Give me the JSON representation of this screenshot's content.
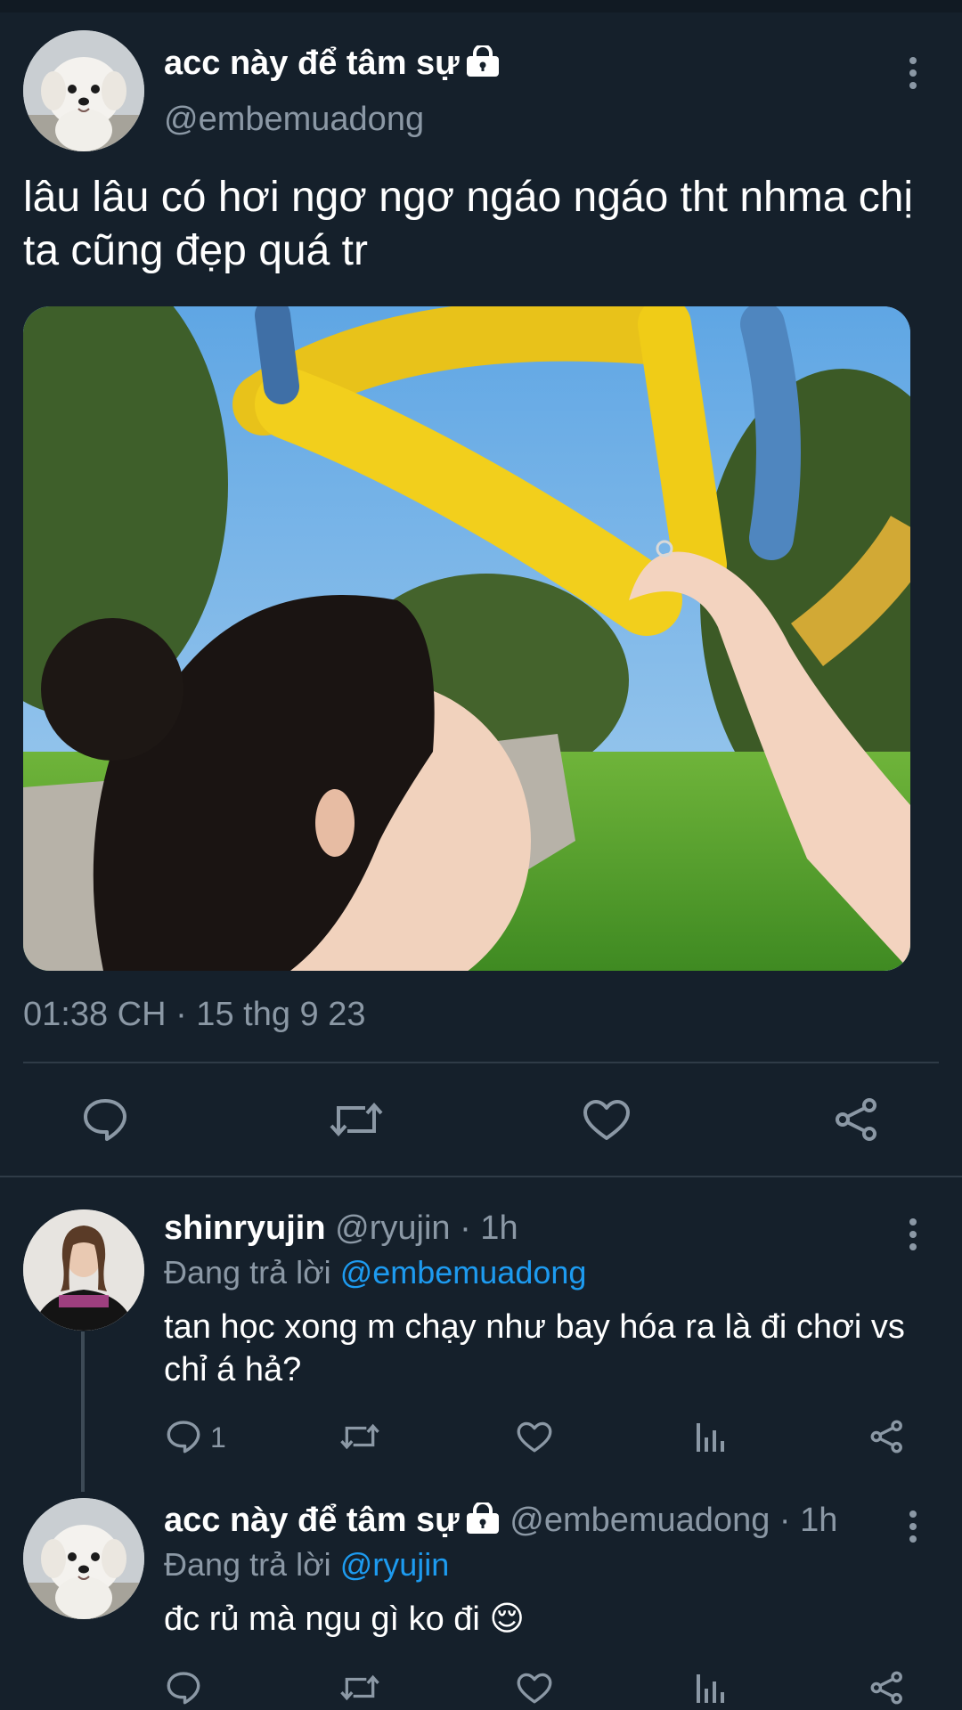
{
  "main_tweet": {
    "display_name": "acc này để tâm sự",
    "handle": "@embemuadong",
    "text": "lâu lâu có hơi ngơ ngơ ngáo ngáo tht nhma chị ta cũng đẹp quá tr",
    "timestamp": "01:38 CH · 15 thg 9 23",
    "actions": [
      "reply-icon",
      "retweet-icon",
      "like-icon",
      "share-icon"
    ]
  },
  "replies": [
    {
      "display_name": "shinryujin",
      "handle": "@ryujin",
      "time": "· 1h",
      "replying_prefix": "Đang trả lời",
      "replying_to": "@embemuadong",
      "text": "tan học xong m chạy như bay hóa ra là đi chơi vs chỉ á hả?",
      "reply_count": "1"
    },
    {
      "display_name": "acc này để tâm sự",
      "handle": "@embemuadong",
      "time": "· 1h",
      "replying_prefix": "Đang trả lời",
      "replying_to": "@ryujin",
      "text": "đc rủ mà ngu gì ko đi 😌"
    }
  ],
  "colors": {
    "background": "#15202b",
    "accent": "#1d9bf0",
    "muted": "#8b98a5"
  }
}
